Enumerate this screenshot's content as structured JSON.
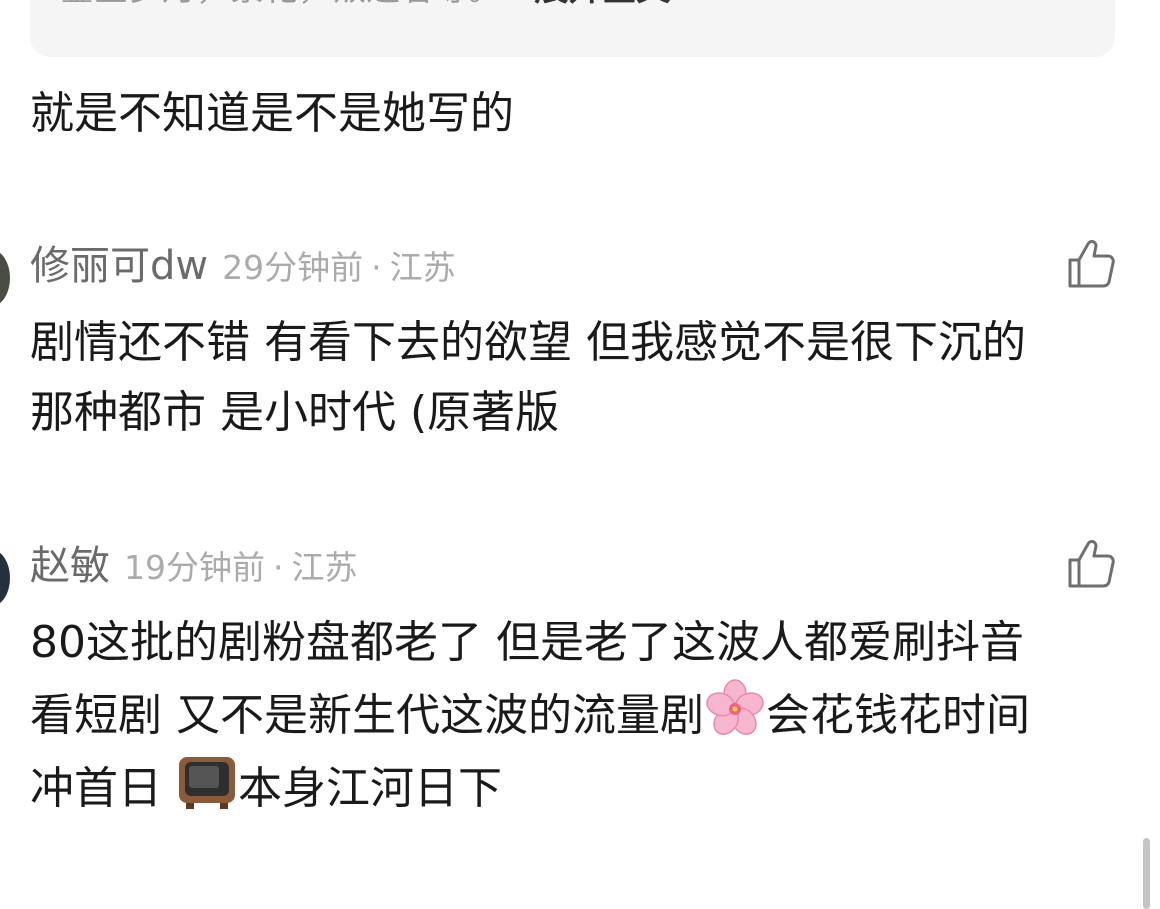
{
  "quote": {
    "text": "鎏金岁月，繁花，叛逆者等。...",
    "expand_label": "展开全文"
  },
  "reply": {
    "text": "就是不知道是不是她写的"
  },
  "comments": [
    {
      "username": "修丽可dw",
      "time": "29分钟前",
      "separator": "·",
      "location": "江苏",
      "lines": [
        "剧情还不错 有看下去的欲望 但我感觉不是很下沉的",
        "那种都市 是小时代 (原著版"
      ]
    },
    {
      "username": "赵敏",
      "time": "19分钟前",
      "separator": "·",
      "location": "江苏",
      "line1": "80这批的剧粉盘都老了 但是老了这波人都爱刷抖音",
      "line2_a": "看短剧 又不是新生代这波的流量剧",
      "line2_b": "会花钱花时间",
      "line3_a": "冲首日 ",
      "line3_b": "本身江河日下"
    }
  ],
  "icons": {
    "like": "thumbs-up-icon",
    "emoji_1": "cherry-blossom-icon",
    "emoji_2": "television-icon",
    "expand": "chevron-down-icon"
  },
  "colors": {
    "text_primary": "#1a1a1a",
    "text_meta": "#ababab",
    "username": "#6b6b6b",
    "card_bg": "#f5f5f5"
  }
}
